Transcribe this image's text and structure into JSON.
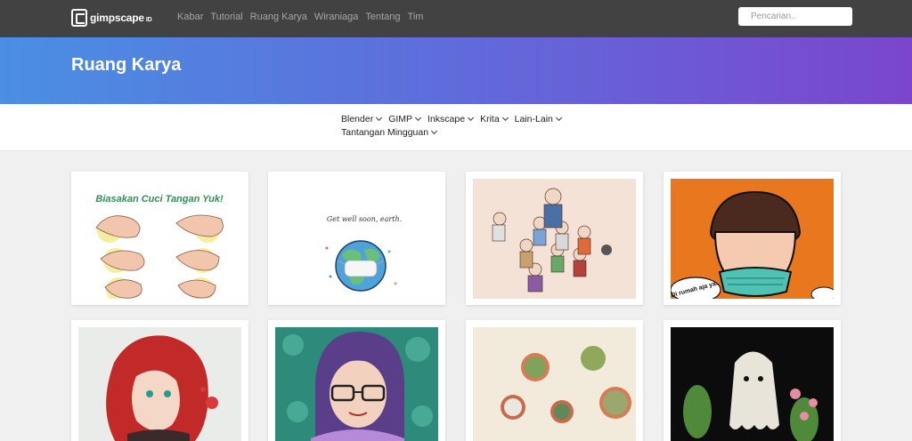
{
  "header": {
    "logo_text": "gimpscape",
    "logo_suffix": "ID",
    "nav": [
      "Kabar",
      "Tutorial",
      "Ruang Karya",
      "Wiraniaga",
      "Tentang",
      "Tim"
    ],
    "search_placeholder": "Pencarian.."
  },
  "hero": {
    "title": "Ruang Karya"
  },
  "categories": [
    "Blender",
    "GIMP",
    "Inkscape",
    "Krita",
    "Lain-Lain",
    "Tantangan Mingguan"
  ],
  "gallery": {
    "card1": {
      "heading": "Biasakan Cuci Tangan Yuk!"
    },
    "card2": {
      "caption": "Get well soon, earth."
    },
    "card4": {
      "speech": "Di rumah aja ya.."
    }
  },
  "colors": {
    "topbar": "#424242",
    "hero_start": "#4a8fe3",
    "hero_end": "#7b46cc",
    "orange": "#e8771e"
  }
}
